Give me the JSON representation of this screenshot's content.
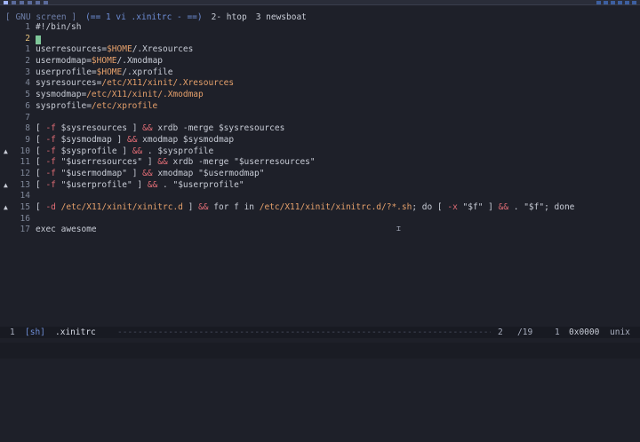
{
  "screen": {
    "title": "[ GNU screen ]",
    "windows": [
      {
        "label": "(== 1 vi .xinitrc - ==)"
      },
      {
        "label": "2- htop"
      },
      {
        "label": "3 newsboat"
      }
    ]
  },
  "editor": {
    "lines": [
      {
        "num": "1",
        "mark": "",
        "code": "#!/bin/sh"
      },
      {
        "num": "2",
        "mark": "",
        "code": ""
      },
      {
        "num": "1",
        "mark": "",
        "code": "userresources=$HOME/.Xresources"
      },
      {
        "num": "2",
        "mark": "",
        "code": "usermodmap=$HOME/.Xmodmap"
      },
      {
        "num": "3",
        "mark": "",
        "code": "userprofile=$HOME/.xprofile"
      },
      {
        "num": "4",
        "mark": "",
        "code": "sysresources=/etc/X11/xinit/.Xresources"
      },
      {
        "num": "5",
        "mark": "",
        "code": "sysmodmap=/etc/X11/xinit/.Xmodmap"
      },
      {
        "num": "6",
        "mark": "",
        "code": "sysprofile=/etc/xprofile"
      },
      {
        "num": "7",
        "mark": "",
        "code": ""
      },
      {
        "num": "8",
        "mark": "",
        "code": "[ -f $sysresources ] && xrdb -merge $sysresources"
      },
      {
        "num": "9",
        "mark": "",
        "code": "[ -f $sysmodmap ] && xmodmap $sysmodmap"
      },
      {
        "num": "10",
        "mark": "▲",
        "code": "[ -f $sysprofile ] && . $sysprofile"
      },
      {
        "num": "11",
        "mark": "",
        "code": "[ -f \"$userresources\" ] && xrdb -merge \"$userresources\""
      },
      {
        "num": "12",
        "mark": "",
        "code": "[ -f \"$usermodmap\" ] && xmodmap \"$usermodmap\""
      },
      {
        "num": "13",
        "mark": "▲",
        "code": "[ -f \"$userprofile\" ] && . \"$userprofile\""
      },
      {
        "num": "14",
        "mark": "",
        "code": ""
      },
      {
        "num": "15",
        "mark": "▲",
        "code": "[ -d /etc/X11/xinit/xinitrc.d ] && for f in /etc/X11/xinit/xinitrc.d/?*.sh; do [ -x \"$f\" ] && . \"$f\"; done"
      },
      {
        "num": "16",
        "mark": "",
        "code": ""
      },
      {
        "num": "17",
        "mark": "",
        "code": "exec awesome"
      }
    ]
  },
  "status": {
    "bufnum": "1",
    "mode": "[sh]",
    "filename": ".xinitrc",
    "position": "2",
    "total": "/19",
    "column": "1",
    "hex": "0x0000",
    "fileformat": "unix"
  },
  "colors": {
    "background": "#1e2029",
    "keyword": "#e06c75",
    "string": "#e5a06b",
    "accent": "#6f8fd8",
    "cursor": "#7ec699"
  }
}
